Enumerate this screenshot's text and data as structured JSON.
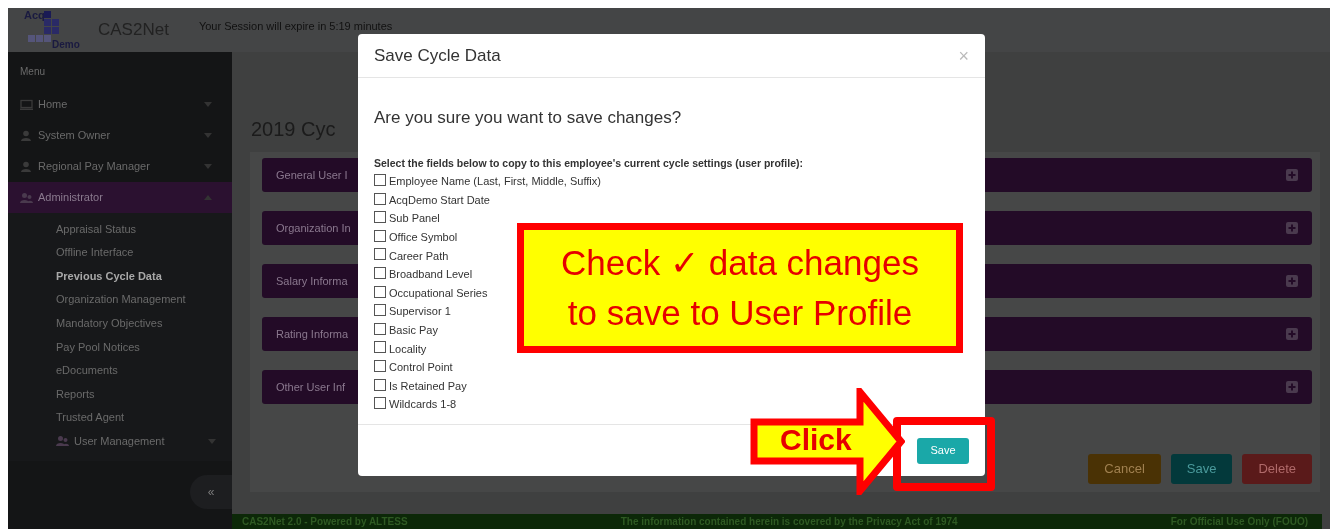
{
  "header": {
    "logo_top": "Acq",
    "logo_bottom": "Demo",
    "app_name": "CAS2Net",
    "session": "Your Session will expire in 5:19 minutes"
  },
  "sidebar": {
    "heading": "Menu",
    "items": [
      {
        "label": "Home",
        "expanded": false,
        "selected": false
      },
      {
        "label": "System Owner",
        "expanded": false,
        "selected": false
      },
      {
        "label": "Regional Pay Manager",
        "expanded": false,
        "selected": false
      },
      {
        "label": "Administrator",
        "expanded": true,
        "selected": true,
        "children": [
          {
            "label": "Appraisal Status",
            "selected": false
          },
          {
            "label": "Offline Interface",
            "selected": false
          },
          {
            "label": "Previous Cycle Data",
            "selected": true
          },
          {
            "label": "Organization Management",
            "selected": false
          },
          {
            "label": "Mandatory Objectives",
            "selected": false
          },
          {
            "label": "Pay Pool Notices",
            "selected": false
          },
          {
            "label": "eDocuments",
            "selected": false
          },
          {
            "label": "Reports",
            "selected": false
          },
          {
            "label": "Trusted Agent",
            "selected": false
          },
          {
            "label": "User Management",
            "expanded": false,
            "selected": false
          }
        ]
      }
    ],
    "collapse": "«"
  },
  "main": {
    "title": "2019 Cyc",
    "panels": [
      {
        "label": "General User I"
      },
      {
        "label": "Organization In"
      },
      {
        "label": "Salary Informa"
      },
      {
        "label": "Rating Informa"
      },
      {
        "label": "Other User Inf"
      }
    ],
    "buttons": [
      {
        "label": "Cancel",
        "kind": "cancel"
      },
      {
        "label": "Save",
        "kind": "save"
      },
      {
        "label": "Delete",
        "kind": "delete"
      }
    ]
  },
  "footer": {
    "left": "CAS2Net 2.0 - Powered by ALTESS",
    "center": "The information contained herein is covered by the Privacy Act of 1974",
    "right": "For Official Use Only (FOUO)"
  },
  "modal": {
    "title": "Save Cycle Data",
    "close": "×",
    "question": "Are you sure you want to save changes?",
    "instruction": "Select the fields below to copy to this employee's current cycle settings (user profile):",
    "fields": [
      {
        "label": "Employee Name (Last, First, Middle, Suffix)",
        "checked": false
      },
      {
        "label": "AcqDemo Start Date",
        "checked": false
      },
      {
        "label": "Sub Panel",
        "checked": false
      },
      {
        "label": "Office Symbol",
        "checked": false
      },
      {
        "label": "Career Path",
        "checked": false
      },
      {
        "label": "Broadband Level",
        "checked": false
      },
      {
        "label": "Occupational Series",
        "checked": false
      },
      {
        "label": "Supervisor 1",
        "checked": false
      },
      {
        "label": "Basic Pay",
        "checked": false
      },
      {
        "label": "Locality",
        "checked": false
      },
      {
        "label": "Control Point",
        "checked": false
      },
      {
        "label": "Is Retained Pay",
        "checked": false
      },
      {
        "label": "Wildcards 1-8",
        "checked": false
      }
    ],
    "buttons": [
      {
        "label": "Save",
        "kind": "save"
      }
    ]
  },
  "annotations": {
    "callout": [
      "Check ✓ data changes",
      "to save to User Profile"
    ],
    "arrow": "Click"
  }
}
